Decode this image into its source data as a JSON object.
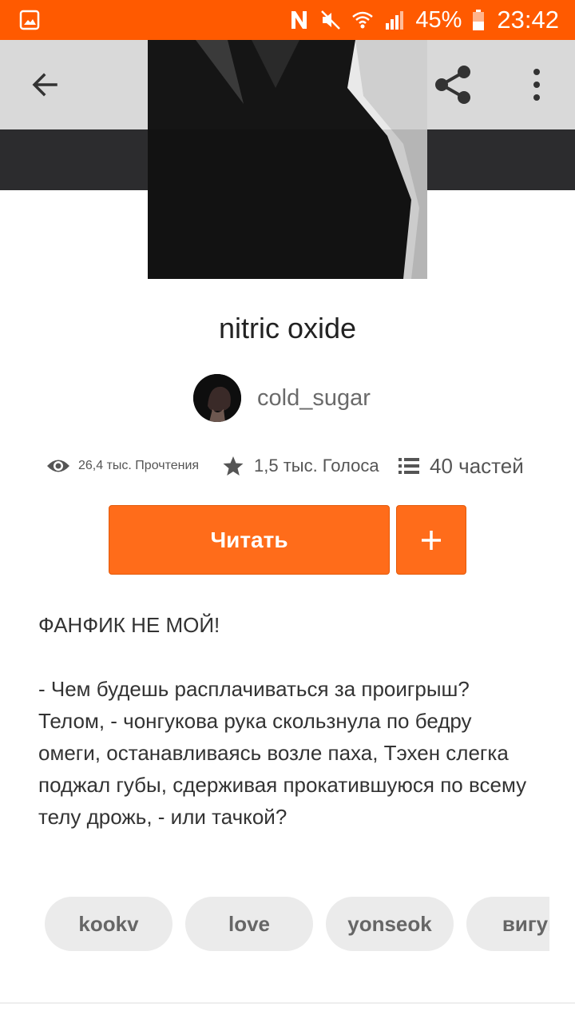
{
  "status_bar": {
    "battery": "45%",
    "time": "23:42",
    "icons": [
      "gallery-icon",
      "n-icon",
      "mute-icon",
      "wifi-icon",
      "signal-icon",
      "battery-icon"
    ],
    "background": "#ff5a00"
  },
  "toolbar": {
    "back_icon": "arrow-left-icon",
    "share_icon": "share-icon",
    "more_icon": "more-vert-icon"
  },
  "story": {
    "title": "nitric oxide",
    "author": "cold_sugar"
  },
  "stats": {
    "reads": "26,4 тыс. Прочтения",
    "votes": "1,5 тыс. Голоса",
    "parts": "40 частей"
  },
  "actions": {
    "read_label": "Читать",
    "add_label": "+"
  },
  "description": {
    "paragraph_1": "ФАНФИК НЕ МОЙ!",
    "paragraph_2": "- Чем будешь расплачиваться за проигрыш? Телом, - чонгукова рука скользнула по бедру омеги, останавливаясь возле паха, Тэхен слегка поджал губы, сдерживая прокатившуюся по всему телу дрожь, - или тачкой?"
  },
  "tags": [
    "kookv",
    "love",
    "yonseok",
    "вигук"
  ],
  "colors": {
    "accent": "#ff6c1a",
    "tag_bg": "#ebebeb"
  }
}
